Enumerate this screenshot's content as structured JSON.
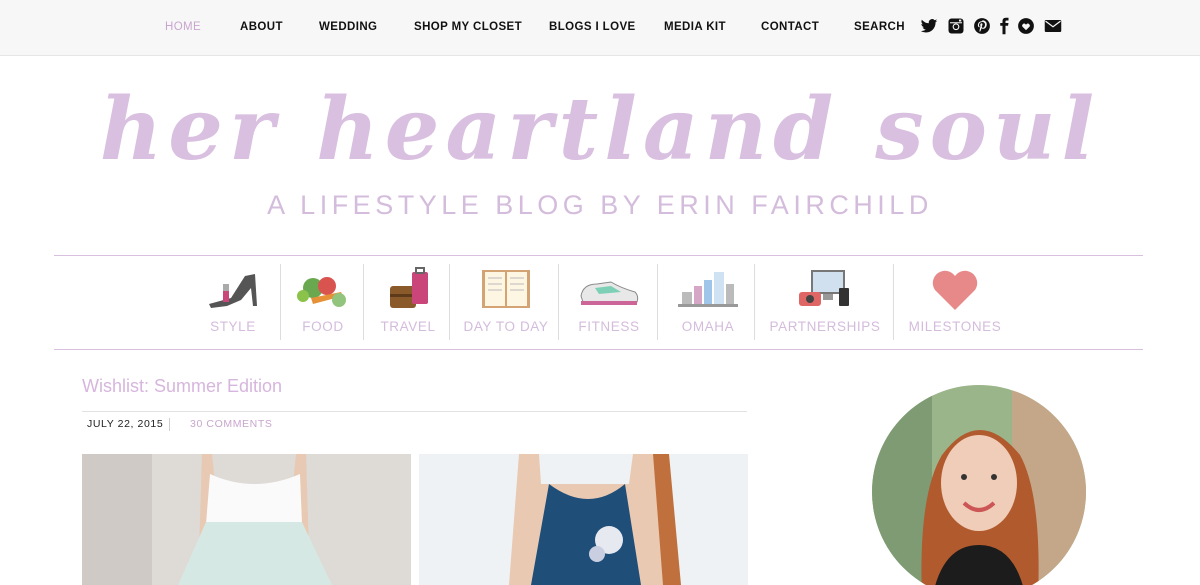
{
  "nav": {
    "items": [
      "HOME",
      "ABOUT",
      "WEDDING",
      "SHOP MY CLOSET",
      "BLOGS I LOVE",
      "MEDIA KIT",
      "CONTACT",
      "SEARCH"
    ],
    "active": "HOME",
    "social_icons": [
      "twitter-icon",
      "instagram-icon",
      "pinterest-icon",
      "facebook-icon",
      "bloglovin-icon",
      "email-icon"
    ]
  },
  "header": {
    "logo": "her heartland soul",
    "tagline": "A LIFESTYLE BLOG BY ERIN FAIRCHILD"
  },
  "categories": [
    "STYLE",
    "FOOD",
    "TRAVEL",
    "DAY TO DAY",
    "FITNESS",
    "OMAHA",
    "PARTNERSHIPS",
    "MILESTONES"
  ],
  "post": {
    "title": "Wishlist: Summer Edition",
    "date": "JULY 22, 2015",
    "comments": "30 COMMENTS"
  },
  "colors": {
    "accent": "#d9bfe0",
    "nav_bg": "#f7f7f7",
    "text": "#222222"
  }
}
